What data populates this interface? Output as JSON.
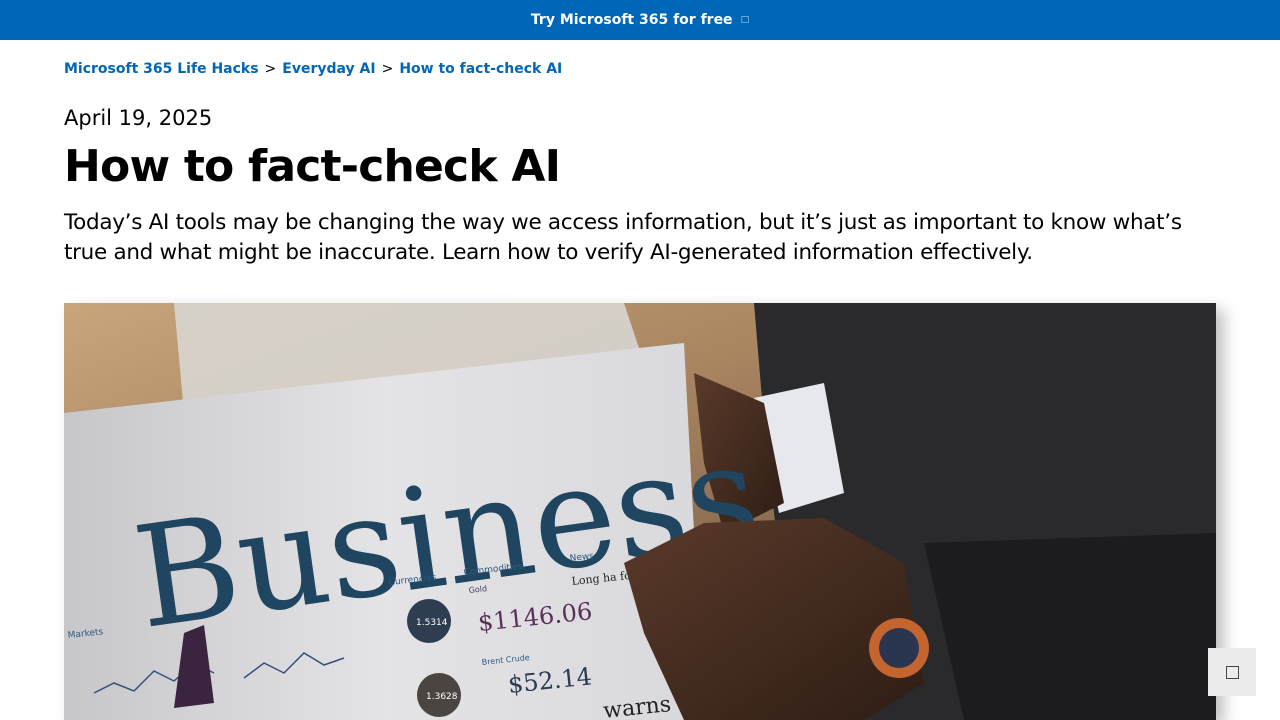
{
  "colors": {
    "brand_blue": "#0067b8",
    "link_blue": "#0067b8",
    "text": "#000000"
  },
  "promo": {
    "label": "Try Microsoft 365 for free",
    "icon": "external-link-icon"
  },
  "breadcrumb": {
    "items": [
      {
        "label": "Microsoft 365 Life Hacks"
      },
      {
        "label": "Everyday AI"
      },
      {
        "label": "How to fact-check AI"
      }
    ],
    "separator": ">"
  },
  "article": {
    "date": "April 19, 2025",
    "title": "How to fact-check AI",
    "summary": "Today’s AI tools may be changing the way we access information, but it’s just as important to know what’s true and what might be inaccurate. Learn how to verify AI-generated information effectively."
  },
  "hero": {
    "newspaper_headline": "Business",
    "markets_label": "Markets",
    "currencies_label": "Currencies",
    "commodities_label": "Commodities",
    "news_label": "News",
    "gold_label": "Gold",
    "gold_price": "$1146.06",
    "crude_label": "Brent Crude",
    "crude_price": "$52.14",
    "news_snippet": "Long ha for Tesc",
    "bottom_headline": "warns IMF",
    "rate1": "1.5314",
    "rate2": "1.3628"
  },
  "feedback": {
    "icon": "feedback-icon"
  }
}
